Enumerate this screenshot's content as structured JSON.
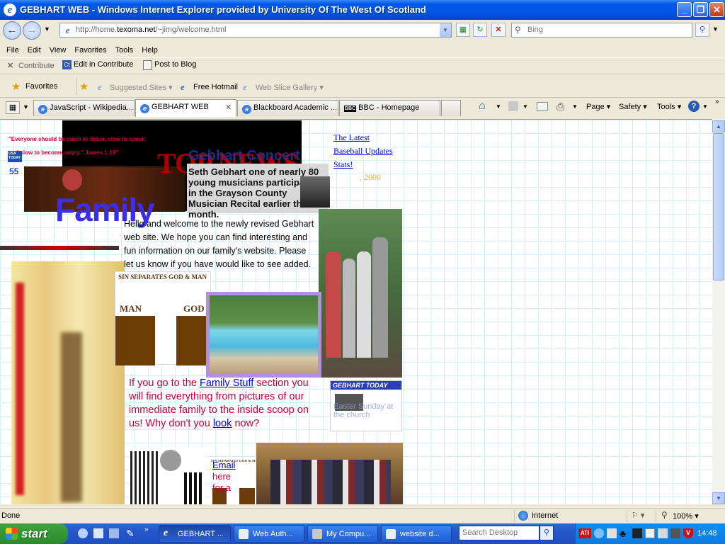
{
  "window": {
    "title": "GEBHART WEB - Windows Internet Explorer provided by University Of The West Of Scotland",
    "minimize": "_",
    "maximize": "❐",
    "close": "✕"
  },
  "address_bar": {
    "url_prefix": "http://home.",
    "url_domain": "texoma.net",
    "url_suffix": "/~jimg/welcome.html",
    "search_placeholder": "Bing"
  },
  "menu": [
    "File",
    "Edit",
    "View",
    "Favorites",
    "Tools",
    "Help"
  ],
  "contribute_bar": {
    "contribute": "Contribute",
    "edit": "Edit in Contribute",
    "post": "Post to Blog"
  },
  "favorites_bar": {
    "favorites": "Favorites",
    "items": [
      {
        "label": "Suggested Sites",
        "dropdown": true,
        "disabled": true
      },
      {
        "label": "Free Hotmail",
        "dropdown": false,
        "disabled": false
      },
      {
        "label": "Web Slice Gallery",
        "dropdown": true,
        "disabled": true
      }
    ]
  },
  "tabs": [
    {
      "label": "JavaScript - Wikipedia...",
      "active": false
    },
    {
      "label": "GEBHART WEB",
      "active": true
    },
    {
      "label": "Blackboard Academic ...",
      "active": false
    },
    {
      "label": "BBC - Homepage",
      "active": false
    }
  ],
  "command_bar": {
    "page": "Page",
    "safety": "Safety",
    "tools": "Tools"
  },
  "page": {
    "quote": "\"Everyone should be quick to listen, slow to speak and slow to become angry.\" James 1:19\"",
    "top_news": "TOP NEWS",
    "family": "Family",
    "concert_title": "Gebhart Concert",
    "concert_text": "Seth Gebhart one of nearly 80 young musicians participating in the Grayson County Musician Recital earlier this month.",
    "baseball_links": [
      "The Latest",
      "Baseball Updates",
      "Stats!"
    ],
    "year": ", 2000",
    "welcome": "Hello and welcome to the newly revised Gebhart web site.  We hope you can find interesting and fun information on our family's website.  Please let us know if you have would like to see added.",
    "sin_banner": "Sin Separates God & Man",
    "man": "MAN",
    "god": "GOD",
    "family_stuff_pre": "If you go to the ",
    "family_stuff_link": "Family Stuff",
    "family_stuff_mid": " section you will find everything from pictures of our immediate family to the inside scoop on us!  Why don't you ",
    "look_link": "look",
    "family_stuff_end": " now?",
    "gebhart_today": "GEBHART TODAY",
    "easter_text": "Easter Sunday at the church",
    "email_link": "Email",
    "email_rest": "here",
    "email_more": "for a",
    "usa_today": "USA TODAY",
    "usa_num": "55"
  },
  "status_bar": {
    "left": "Done",
    "zone": "Internet",
    "zoom": "100%"
  },
  "taskbar": {
    "start": "start",
    "tasks": [
      {
        "label": "GEBHART ...",
        "active": true
      },
      {
        "label": "Web Auth...",
        "active": false
      },
      {
        "label": "My Compu...",
        "active": false
      },
      {
        "label": "website d...",
        "active": false
      }
    ],
    "search_placeholder": "Search Desktop",
    "clock": "14:48"
  }
}
